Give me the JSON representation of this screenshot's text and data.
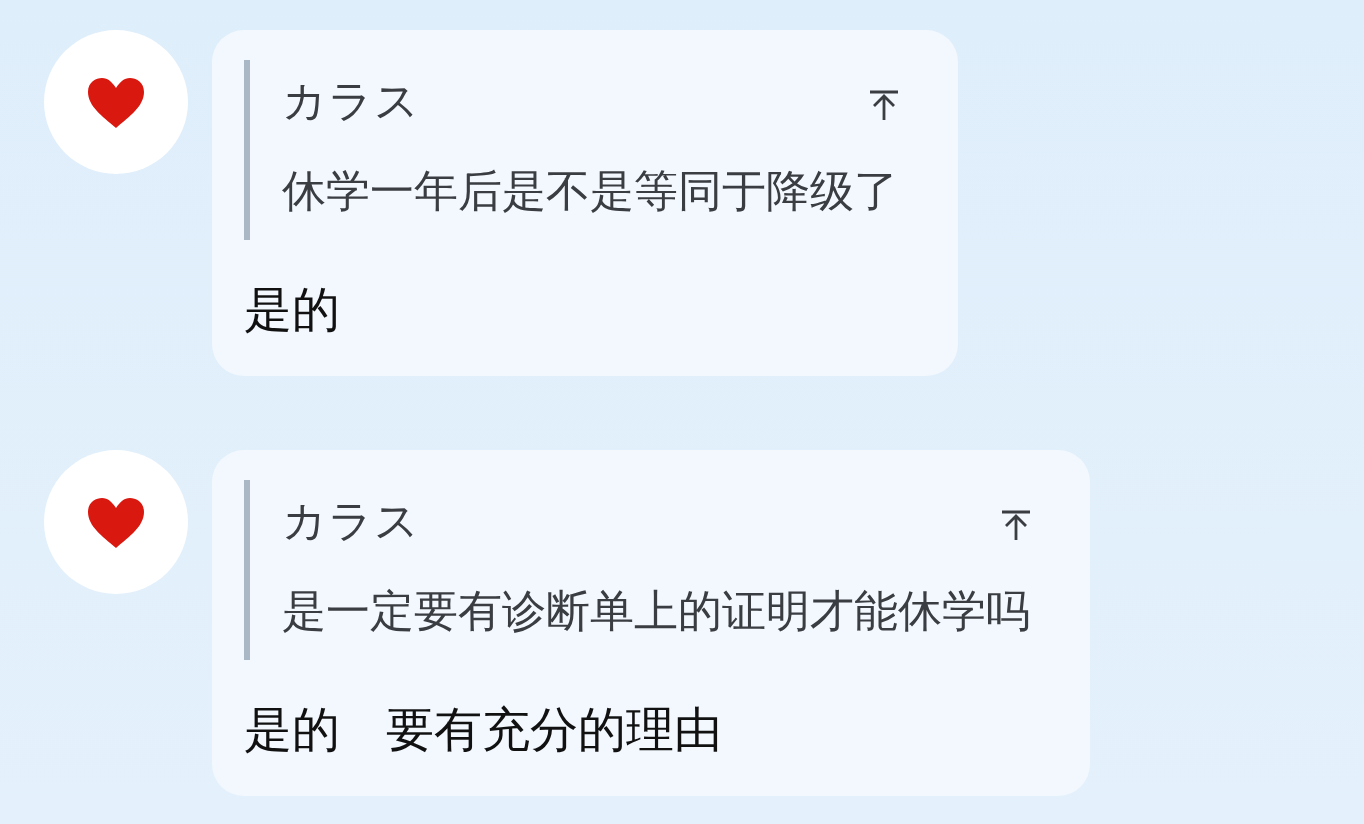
{
  "messages": [
    {
      "quote": {
        "author": "カラス",
        "text": "休学一年后是不是等同于降级了"
      },
      "reply": "是的"
    },
    {
      "quote": {
        "author": "カラス",
        "text": "是一定要有诊断单上的证明才能休学吗"
      },
      "reply": "是的   要有充分的理由"
    }
  ]
}
